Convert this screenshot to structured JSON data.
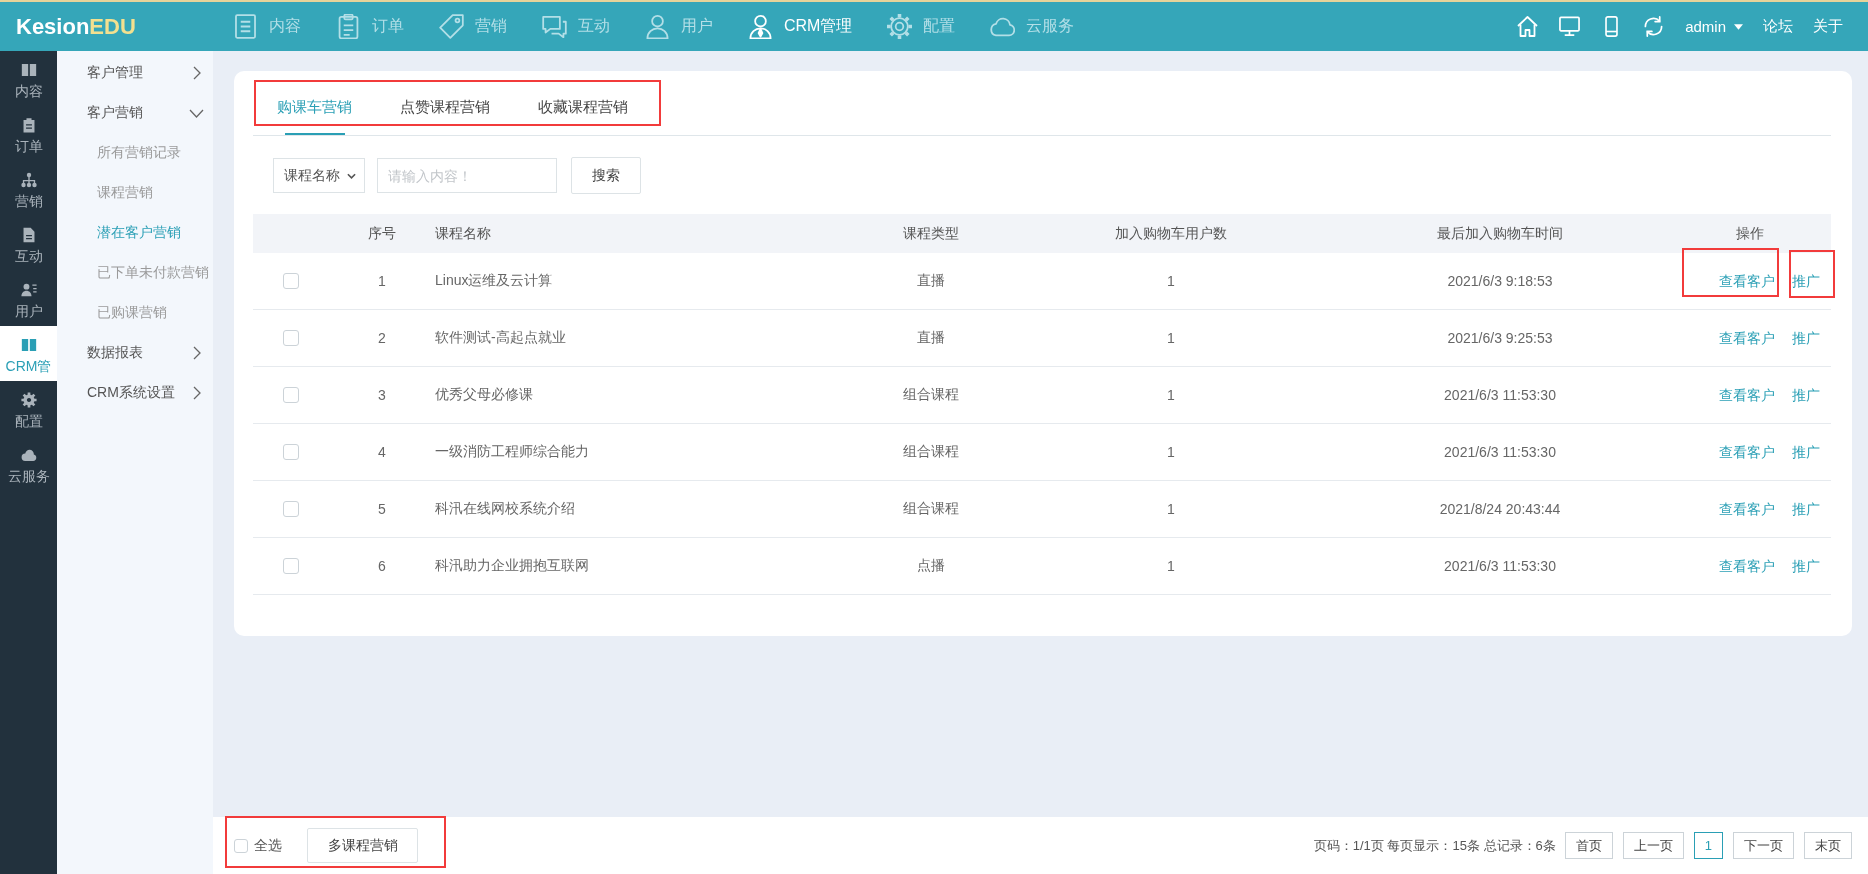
{
  "top_bar": {
    "logo": {
      "part_1": "Kesion",
      "part_2": "EDU"
    },
    "nav": [
      {
        "label": "内容",
        "selected": false
      },
      {
        "label": "订单",
        "selected": false
      },
      {
        "label": "营销",
        "selected": false
      },
      {
        "label": "互动",
        "selected": false
      },
      {
        "label": "用户",
        "selected": false
      },
      {
        "label": "CRM管理",
        "selected": true
      },
      {
        "label": "配置",
        "selected": false
      },
      {
        "label": "云服务",
        "selected": false
      }
    ],
    "user": "admin",
    "links": [
      "论坛",
      "关于"
    ]
  },
  "rail": [
    {
      "label": "内容",
      "selected": false
    },
    {
      "label": "订单",
      "selected": false
    },
    {
      "label": "营销",
      "selected": false
    },
    {
      "label": "互动",
      "selected": false
    },
    {
      "label": "用户",
      "selected": false
    },
    {
      "label": "CRM管",
      "selected": true
    },
    {
      "label": "配置",
      "selected": false
    },
    {
      "label": "云服务",
      "selected": false
    }
  ],
  "sidebar": [
    {
      "label": "客户管理",
      "expanded": false
    },
    {
      "label": "客户营销",
      "expanded": true,
      "children": [
        {
          "label": "所有营销记录",
          "selected": false
        },
        {
          "label": "课程营销",
          "selected": false
        },
        {
          "label": "潜在客户营销",
          "selected": true
        },
        {
          "label": "已下单未付款营销",
          "selected": false
        },
        {
          "label": "已购课营销",
          "selected": false
        }
      ]
    },
    {
      "label": "数据报表",
      "expanded": false
    },
    {
      "label": "CRM系统设置",
      "expanded": false
    }
  ],
  "tab_bar": {
    "highlighted": true,
    "tabs": [
      {
        "label": "购课车营销",
        "selected": true
      },
      {
        "label": "点赞课程营销",
        "selected": false
      },
      {
        "label": "收藏课程营销",
        "selected": false
      }
    ]
  },
  "search": {
    "field": "课程名称",
    "placeholder": "请输入内容！",
    "button": "搜索"
  },
  "table": {
    "columns": [
      "序号",
      "课程名称",
      "课程类型",
      "加入购物车用户数",
      "最后加入购物车时间",
      "操作"
    ],
    "rows": [
      {
        "checked": false,
        "index": "1",
        "name": "Linux运维及云计算",
        "type": "直播",
        "count": "1",
        "time": "2021/6/3 9:18:53",
        "actions": [
          {
            "label": "查看客户",
            "highlighted": true
          },
          {
            "label": "推广",
            "highlighted": true
          }
        ]
      },
      {
        "checked": false,
        "index": "2",
        "name": "软件测试-高起点就业",
        "type": "直播",
        "count": "1",
        "time": "2021/6/3 9:25:53",
        "actions": [
          {
            "label": "查看客户",
            "highlighted": false
          },
          {
            "label": "推广",
            "highlighted": false
          }
        ]
      },
      {
        "checked": false,
        "index": "3",
        "name": "优秀父母必修课",
        "type": "组合课程",
        "count": "1",
        "time": "2021/6/3 11:53:30",
        "actions": [
          {
            "label": "查看客户",
            "highlighted": false
          },
          {
            "label": "推广",
            "highlighted": false
          }
        ]
      },
      {
        "checked": false,
        "index": "4",
        "name": "一级消防工程师综合能力",
        "type": "组合课程",
        "count": "1",
        "time": "2021/6/3 11:53:30",
        "actions": [
          {
            "label": "查看客户",
            "highlighted": false
          },
          {
            "label": "推广",
            "highlighted": false
          }
        ]
      },
      {
        "checked": false,
        "index": "5",
        "name": "科汛在线网校系统介绍",
        "type": "组合课程",
        "count": "1",
        "time": "2021/8/24 20:43:44",
        "actions": [
          {
            "label": "查看客户",
            "highlighted": false
          },
          {
            "label": "推广",
            "highlighted": false
          }
        ]
      },
      {
        "checked": false,
        "index": "6",
        "name": "科汛助力企业拥抱互联网",
        "type": "点播",
        "count": "1",
        "time": "2021/6/3 11:53:30",
        "actions": [
          {
            "label": "查看客户",
            "highlighted": false
          },
          {
            "label": "推广",
            "highlighted": false
          }
        ]
      }
    ]
  },
  "footer": {
    "highlighted": true,
    "select_all": {
      "label": "全选",
      "checked": false
    },
    "bulk_button": "多课程营销",
    "summary": "页码：1/1页 每页显示：15条 总记录：6条",
    "pager": [
      {
        "label": "首页",
        "selected": false
      },
      {
        "label": "上一页",
        "selected": false
      },
      {
        "label": "1",
        "selected": true
      },
      {
        "label": "下一页",
        "selected": false
      },
      {
        "label": "末页",
        "selected": false
      }
    ]
  }
}
